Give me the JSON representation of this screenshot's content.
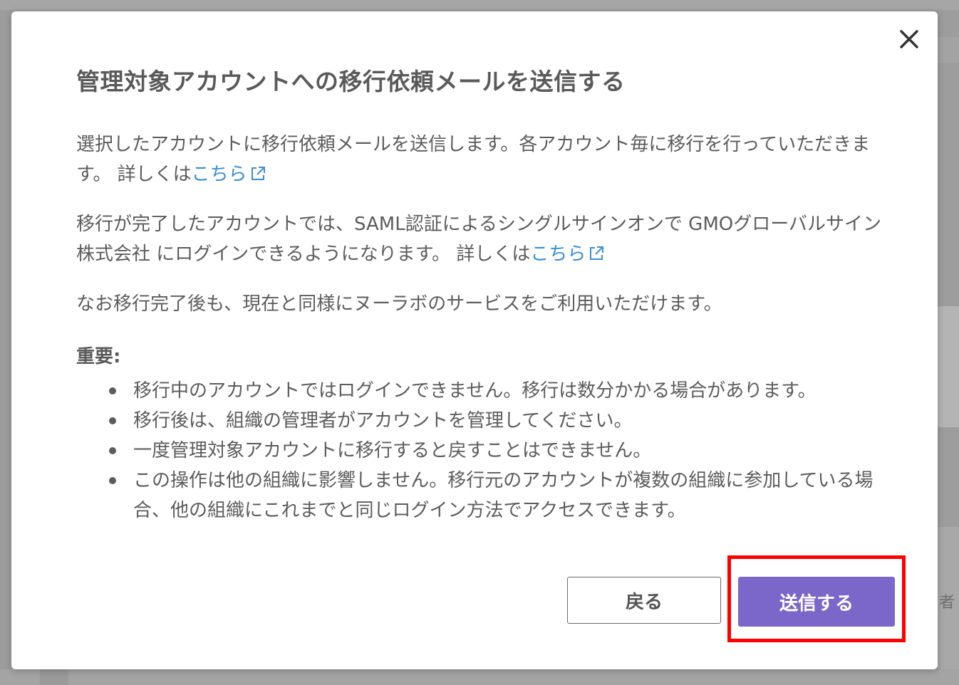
{
  "modal": {
    "title": "管理対象アカウントへの移行依頼メールを送信する",
    "paragraph1": {
      "text": "選択したアカウントに移行依頼メールを送信します。各アカウント毎に移行を行っていただきます。 詳しくは",
      "link": "こちら"
    },
    "paragraph2": {
      "text": "移行が完了したアカウントでは、SAML認証によるシングルサインオンで GMOグローバルサイン株式会社 にログインできるようになります。 詳しくは",
      "link": "こちら"
    },
    "paragraph3": "なお移行完了後も、現在と同様にヌーラボのサービスをご利用いただけます。",
    "important": {
      "heading": "重要:",
      "items": [
        "移行中のアカウントではログインできません。移行は数分かかる場合があります。",
        "移行後は、組織の管理者がアカウントを管理してください。",
        "一度管理対象アカウントに移行すると戻すことはできません。",
        "この操作は他の組織に影響しません。移行元のアカウントが複数の組織に参加している場合、他の組織にこれまでと同じログイン方法でアクセスできます。"
      ]
    },
    "buttons": {
      "back": "戻る",
      "send": "送信する"
    },
    "icons": {
      "close": "close-icon",
      "external_link": "external-link-icon"
    },
    "colors": {
      "primary": "#7b66c9",
      "link": "#3b8fd1",
      "highlight": "#ff0000"
    }
  },
  "background": {
    "edge_char": "者"
  }
}
